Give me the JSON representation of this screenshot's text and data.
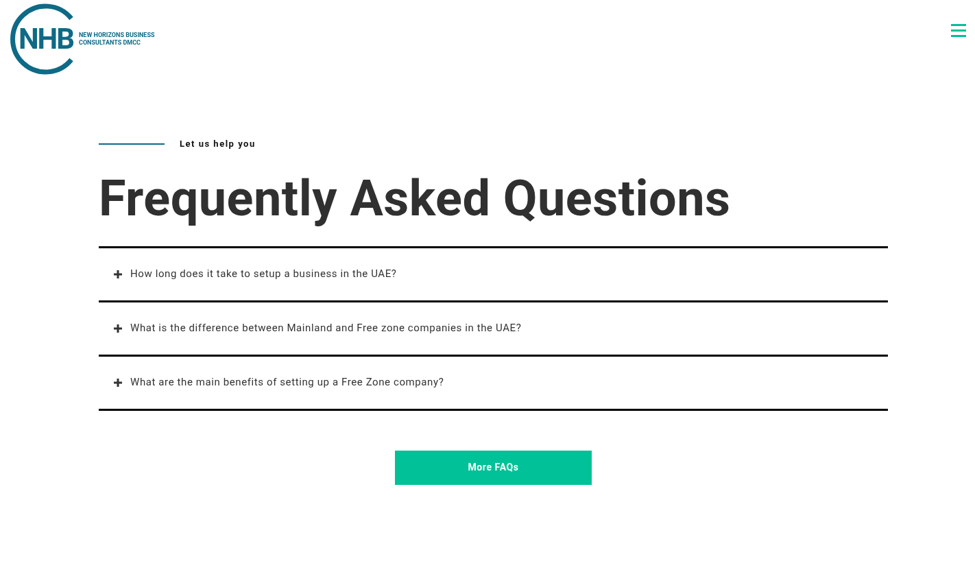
{
  "header": {
    "logo_mark": "NHB",
    "logo_text": [
      "NEW HORIZONS BUSINESS",
      "CONSULTANTS DMCC"
    ]
  },
  "section": {
    "eyebrow": "Let us help you",
    "title": "Frequently Asked Questions"
  },
  "faqs": [
    {
      "question": "How long does it take to setup a business in the UAE?",
      "expanded": false
    },
    {
      "question": "What is the difference between Mainland and Free zone companies in the UAE?",
      "expanded": false
    },
    {
      "question": "What are the main benefits of setting up a Free Zone company?",
      "expanded": false
    }
  ],
  "button": "More FAQs"
}
